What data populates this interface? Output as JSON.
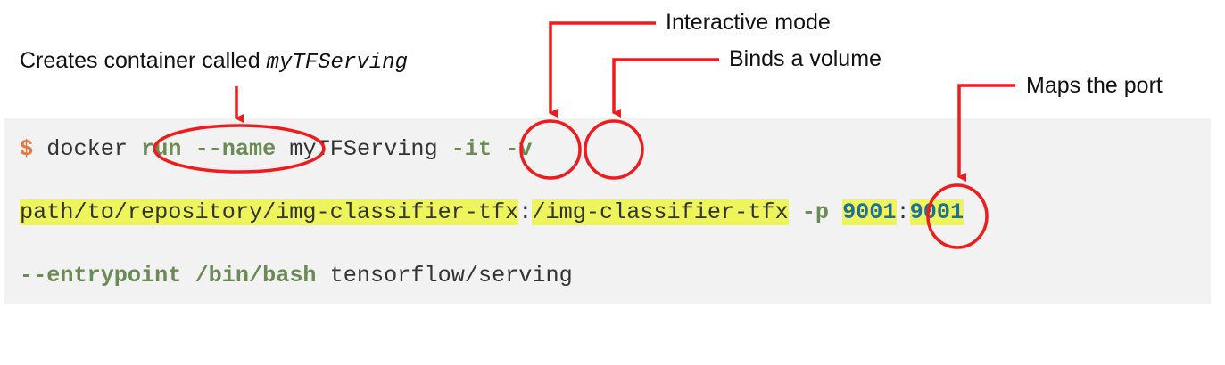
{
  "annotations": {
    "creates_container": "Creates container called",
    "container_name": "myTFServing",
    "interactive_mode": "Interactive mode",
    "binds_volume": "Binds a volume",
    "maps_port": "Maps the port"
  },
  "code": {
    "line1": {
      "prompt": "$",
      "cmd": "docker",
      "run": "run",
      "name_flag": "--name",
      "name_value": "myTFServing",
      "it_flag": "-it",
      "v_flag": "-v"
    },
    "line2": {
      "host_path": "path/to/repository/img-classifier-tfx",
      "sep1": ":",
      "container_path": "/img-classifier-tfx",
      "p_flag": "-p",
      "host_port": "9001",
      "sep2": ":",
      "container_port": "9001"
    },
    "line3": {
      "entry_flag": "--entrypoint",
      "entry_value": "/bin/bash",
      "image": "tensorflow/serving"
    }
  },
  "colors": {
    "annotation": "#ee1c1c",
    "prompt": "#e8763a",
    "keyword": "#6b8a55",
    "number": "#1f6f9c",
    "highlight": "#eef55c",
    "code_bg": "#f2f2f2"
  }
}
